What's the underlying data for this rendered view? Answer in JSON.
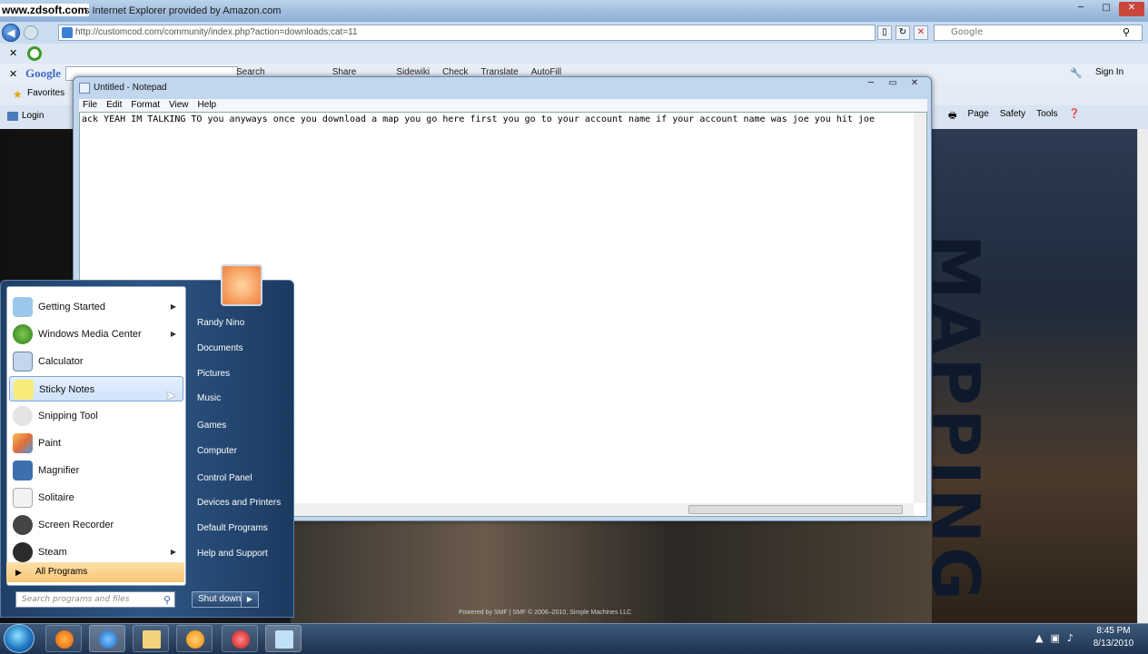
{
  "watermark": "www.zdsoft.com",
  "ie": {
    "window_title": "s Internet Explorer provided by Amazon.com",
    "address": "http://customcod.com/community/index.php?action=downloads;cat=11",
    "search_placeholder": "Google",
    "google_bar_logo": "Google",
    "toolbar_items": [
      "Search",
      "Share",
      "Sidewiki",
      "Check",
      "Translate",
      "AutoFill"
    ],
    "sign_in": "Sign In",
    "favorites": "Favorites",
    "login": "Login",
    "command_bar": [
      "Page",
      "Safety",
      "Tools"
    ]
  },
  "webpage": {
    "poster_text": "MAPPING",
    "credit": "Powered by SMF | SMF © 2006–2010, Simple Machines LLC"
  },
  "notepad": {
    "title": "Untitled - Notepad",
    "menu": [
      "File",
      "Edit",
      "Format",
      "View",
      "Help"
    ],
    "content": "ack YEAH IM TALKING TO you anyways once you download a map you go here first you go to your account name if your account name was joe you hit joe"
  },
  "start_menu": {
    "left_items": [
      {
        "label": "Getting Started",
        "icon": "getting-started-icon",
        "arrow": true
      },
      {
        "label": "Windows Media Center",
        "icon": "media-center-icon",
        "arrow": true
      },
      {
        "label": "Calculator",
        "icon": "calculator-icon",
        "arrow": false
      },
      {
        "label": "Sticky Notes",
        "icon": "sticky-notes-icon",
        "arrow": false
      },
      {
        "label": "Snipping Tool",
        "icon": "snipping-tool-icon",
        "arrow": false
      },
      {
        "label": "Paint",
        "icon": "paint-icon",
        "arrow": false
      },
      {
        "label": "Magnifier",
        "icon": "magnifier-icon",
        "arrow": false
      },
      {
        "label": "Solitaire",
        "icon": "solitaire-icon",
        "arrow": false
      },
      {
        "label": "Screen Recorder",
        "icon": "screen-recorder-icon",
        "arrow": false
      },
      {
        "label": "Steam",
        "icon": "steam-icon",
        "arrow": true
      }
    ],
    "all_programs": "All Programs",
    "search_placeholder": "Search programs and files",
    "right_items": [
      "Randy Nino",
      "Documents",
      "Pictures",
      "Music",
      "Games",
      "Computer",
      "Control Panel",
      "Devices and Printers",
      "Default Programs",
      "Help and Support"
    ],
    "shutdown": "Shut down"
  },
  "taskbar": {
    "time": "8:45 PM",
    "date": "8/13/2010"
  }
}
